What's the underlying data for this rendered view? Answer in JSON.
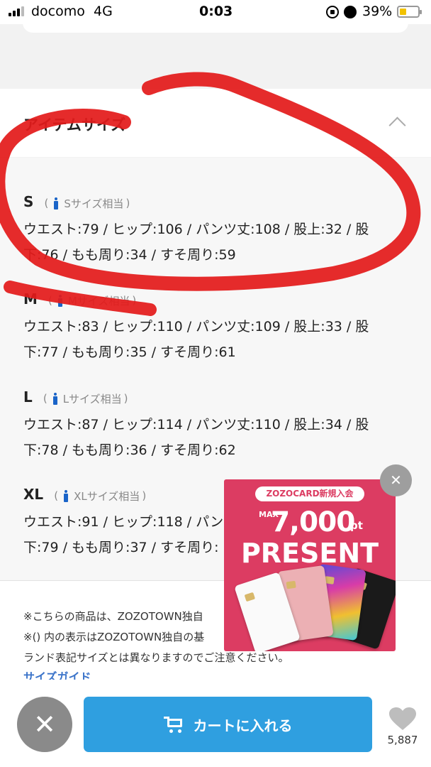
{
  "status_bar": {
    "carrier": "docomo",
    "network": "4G",
    "time": "0:03",
    "battery_percent": "39%",
    "battery_level": 0.39,
    "battery_color": "#f2c200"
  },
  "section": {
    "title": "アイテムサイズ",
    "collapse_icon": "chevron-up-icon"
  },
  "sizes": [
    {
      "label": "S",
      "equivalent": "Sサイズ相当",
      "measurements_line1": "ウエスト:79 / ヒップ:106 / パンツ丈:108 / 股上:32 / 股",
      "measurements_line2": "下:76 / もも周り:34 / すそ周り:59"
    },
    {
      "label": "M",
      "equivalent": "Mサイズ相当",
      "measurements_line1": "ウエスト:83 / ヒップ:110 / パンツ丈:109 / 股上:33 / 股",
      "measurements_line2": "下:77 / もも周り:35 / すそ周り:61"
    },
    {
      "label": "L",
      "equivalent": "Lサイズ相当",
      "measurements_line1": "ウエスト:87 / ヒップ:114 / パンツ丈:110 / 股上:34 / 股",
      "measurements_line2": "下:78 / もも周り:36 / すそ周り:62"
    },
    {
      "label": "XL",
      "equivalent": "XLサイズ相当",
      "measurements_line1": "ウエスト:91 / ヒップ:118 / パン",
      "measurements_line2": "下:79 / もも周り:37 / すそ周り:"
    }
  ],
  "notes": {
    "line1": "※こちらの商品は、ZOZOTOWN独自",
    "line2": "※() 内の表示はZOZOTOWN独自の基",
    "line3": "ランド表記サイズとは異なりますのでご注意ください。",
    "size_guide_link": "サイズガイド"
  },
  "promo": {
    "header": "ZOZOCARD新規入会",
    "max_label": "MAX",
    "amount": "7,000",
    "unit": "pt",
    "present": "PRESENT",
    "bg_color": "#dc3c62"
  },
  "bottom_bar": {
    "cart_label": "カートに入れる",
    "favorite_count": "5,887",
    "accent_color": "#2f9fe0"
  }
}
